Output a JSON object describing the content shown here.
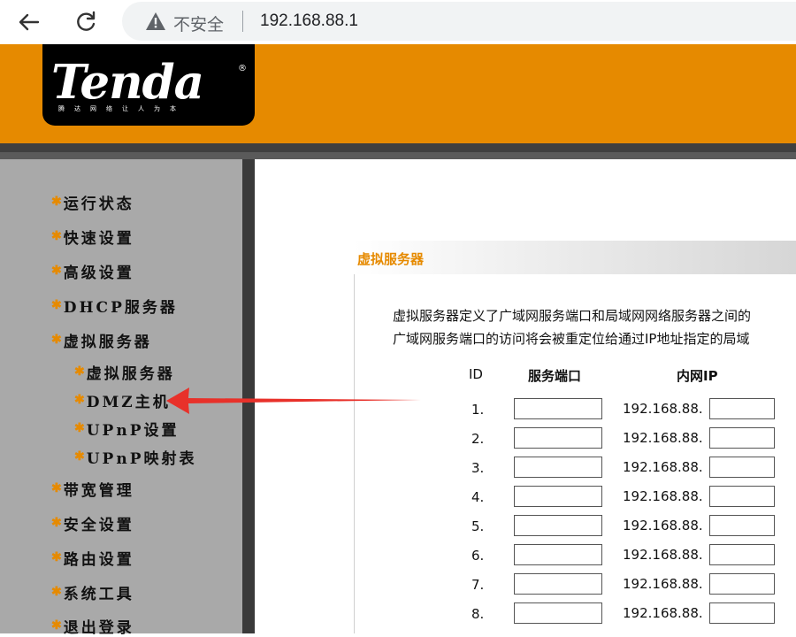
{
  "browser": {
    "security_label": "不安全",
    "url": "192.168.88.1"
  },
  "brand": {
    "logo_text": "Tenda",
    "reg_mark": "®",
    "slogan": "腾达网络让人为本"
  },
  "sidebar": {
    "items": [
      {
        "label": "运行状态"
      },
      {
        "label": "快速设置"
      },
      {
        "label": "高级设置"
      },
      {
        "label": "DHCP服务器"
      },
      {
        "label": "虚拟服务器"
      }
    ],
    "subitems": [
      {
        "label": "虚拟服务器"
      },
      {
        "label": "DMZ主机"
      },
      {
        "label": "UPnP设置"
      },
      {
        "label": "UPnP映射表"
      }
    ],
    "items_after": [
      {
        "label": "带宽管理"
      },
      {
        "label": "安全设置"
      },
      {
        "label": "路由设置"
      },
      {
        "label": "系统工具"
      },
      {
        "label": "退出登录"
      }
    ]
  },
  "main": {
    "section_title": "虚拟服务器",
    "description_line1": "虚拟服务器定义了广域网服务端口和局域网网络服务器之间的",
    "description_line2": "广域网服务端口的访问将会被重定位给通过IP地址指定的局域",
    "columns": {
      "id": "ID",
      "port": "服务端口",
      "ip": "内网IP"
    },
    "ip_prefix": "192.168.88.",
    "rows": [
      {
        "id": "1.",
        "port": "",
        "ip_suffix": ""
      },
      {
        "id": "2.",
        "port": "",
        "ip_suffix": ""
      },
      {
        "id": "3.",
        "port": "",
        "ip_suffix": ""
      },
      {
        "id": "4.",
        "port": "",
        "ip_suffix": ""
      },
      {
        "id": "5.",
        "port": "",
        "ip_suffix": ""
      },
      {
        "id": "6.",
        "port": "",
        "ip_suffix": ""
      },
      {
        "id": "7.",
        "port": "",
        "ip_suffix": ""
      },
      {
        "id": "8.",
        "port": "",
        "ip_suffix": ""
      }
    ]
  },
  "colors": {
    "brand_orange": "#e68a00",
    "sidebar_gray": "#a9a9a9",
    "annotation_red": "#e8312a"
  },
  "annotation": {
    "type": "arrow",
    "points_to": "DMZ主机"
  }
}
